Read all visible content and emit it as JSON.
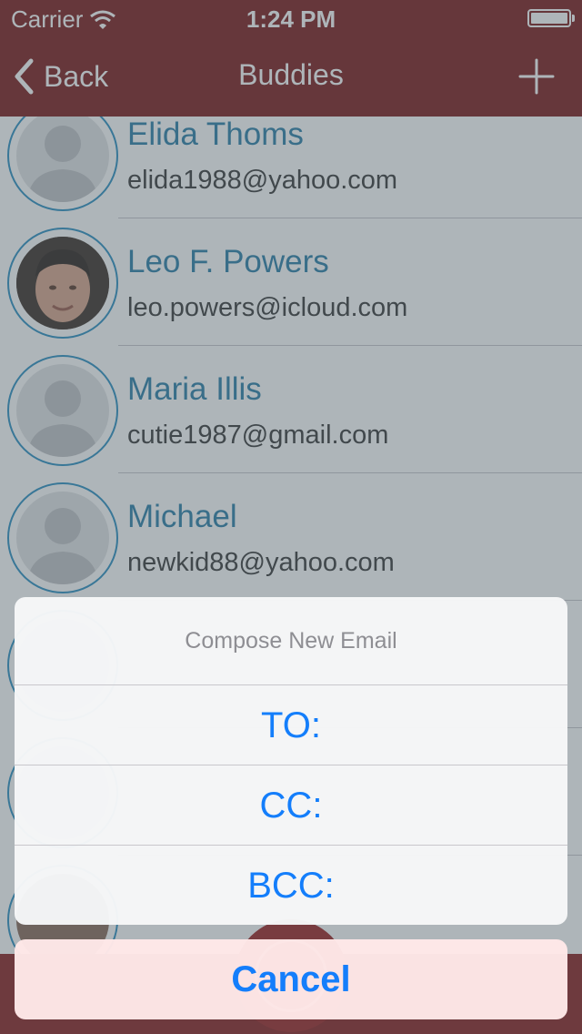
{
  "status_bar": {
    "carrier": "Carrier",
    "time": "1:24 PM"
  },
  "nav": {
    "back_label": "Back",
    "title": "Buddies",
    "add_icon": "plus-icon"
  },
  "contacts": [
    {
      "name": "Elida Thoms",
      "email": "elida1988@yahoo.com",
      "avatar": "placeholder"
    },
    {
      "name": "Leo F. Powers",
      "email": "leo.powers@icloud.com",
      "avatar": "photo"
    },
    {
      "name": "Maria Illis",
      "email": "cutie1987@gmail.com",
      "avatar": "placeholder"
    },
    {
      "name": "Michael",
      "email": "newkid88@yahoo.com",
      "avatar": "placeholder"
    }
  ],
  "action_sheet": {
    "title": "Compose New Email",
    "options": [
      "TO:",
      "CC:",
      "BCC:"
    ],
    "cancel": "Cancel"
  },
  "colors": {
    "nav_bar": "#7d1b1b",
    "name_text": "#2b7ea8",
    "avatar_ring": "#2b8fc2",
    "action_text": "#147efb"
  }
}
